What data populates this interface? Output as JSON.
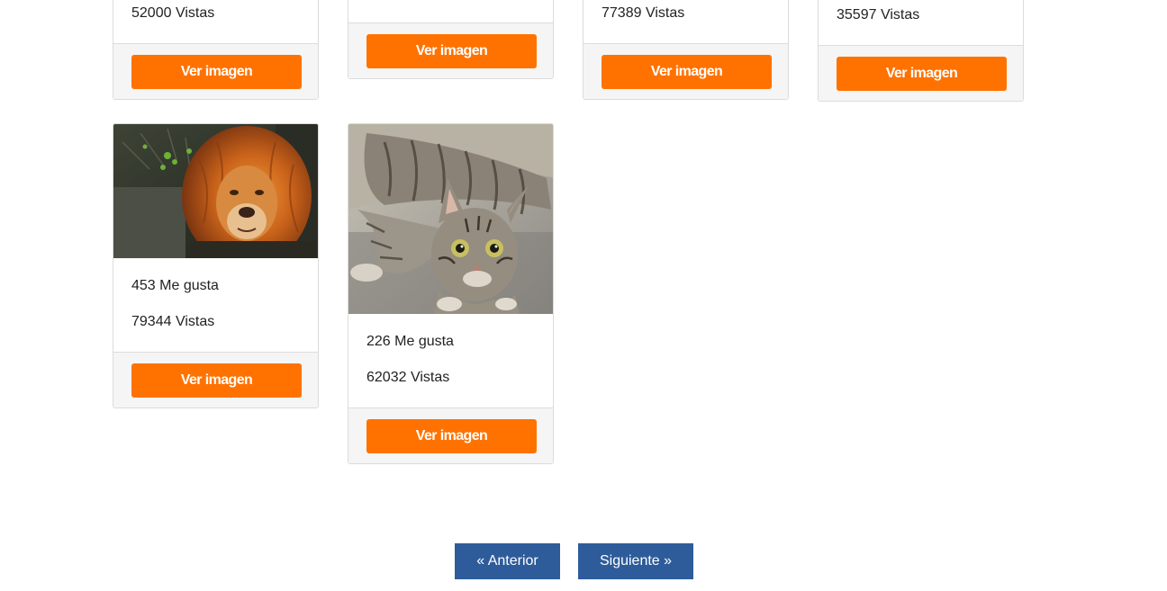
{
  "cards": [
    {
      "views": "52000 Vistas",
      "button": "Ver imagen"
    },
    {
      "button": "Ver imagen"
    },
    {
      "views": "77389 Vistas",
      "button": "Ver imagen"
    },
    {
      "views": "35597 Vistas",
      "button": "Ver imagen"
    },
    {
      "image": "lion-photo",
      "likes": "453 Me gusta",
      "views": "79344 Vistas",
      "button": "Ver imagen"
    },
    {
      "image": "cat-photo",
      "likes": "226 Me gusta",
      "views": "62032 Vistas",
      "button": "Ver imagen"
    }
  ],
  "pagination": {
    "prev_label": "« Anterior",
    "next_label": "Siguiente »"
  },
  "colors": {
    "accent": "#ff7200",
    "pager": "#2e5c9a",
    "footer_bg": "#f5f5f5",
    "border": "#dcdcdc"
  }
}
